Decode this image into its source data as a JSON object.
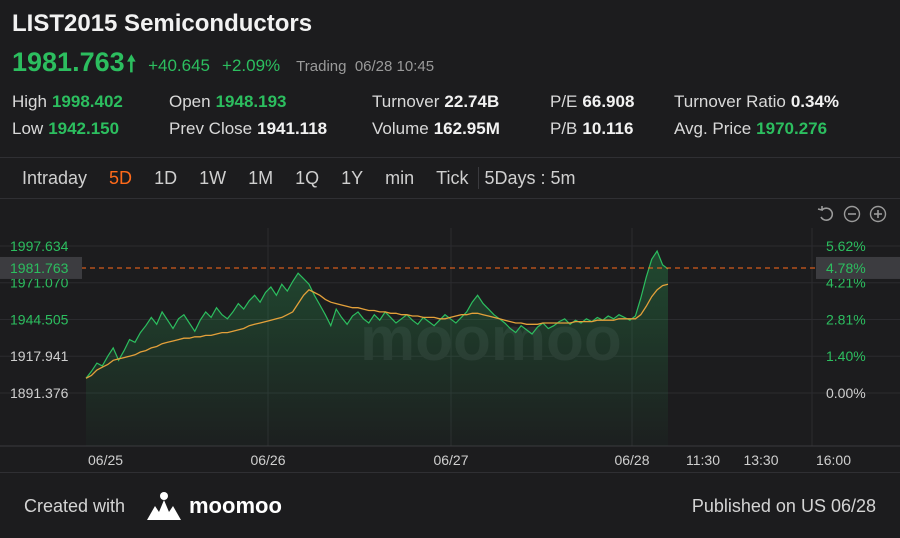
{
  "header": {
    "title": "LIST2015 Semiconductors",
    "price": "1981.763",
    "change": "+40.645",
    "change_pct": "+2.09%",
    "status": "Trading",
    "datetime": "06/28 10:45"
  },
  "stats": {
    "high_label": "High",
    "high": "1998.402",
    "low_label": "Low",
    "low": "1942.150",
    "open_label": "Open",
    "open": "1948.193",
    "prev_close_label": "Prev Close",
    "prev_close": "1941.118",
    "turnover_label": "Turnover",
    "turnover": "22.74B",
    "volume_label": "Volume",
    "volume": "162.95M",
    "pe_label": "P/E",
    "pe": "66.908",
    "pb_label": "P/B",
    "pb": "10.116",
    "turnover_ratio_label": "Turnover Ratio",
    "turnover_ratio": "0.34%",
    "avg_price_label": "Avg. Price",
    "avg_price": "1970.276"
  },
  "tabs": [
    {
      "label": "Intraday",
      "active": false
    },
    {
      "label": "5D",
      "active": true
    },
    {
      "label": "1D",
      "active": false
    },
    {
      "label": "1W",
      "active": false
    },
    {
      "label": "1M",
      "active": false
    },
    {
      "label": "1Q",
      "active": false
    },
    {
      "label": "1Y",
      "active": false
    },
    {
      "label": "min",
      "active": false
    },
    {
      "label": "Tick",
      "active": false
    }
  ],
  "interval": "5Days : 5m",
  "controls": [
    "reset-icon",
    "zoom-out-icon",
    "zoom-in-icon"
  ],
  "colors": {
    "up": "#2cbe5f",
    "avg_line": "#e3a03a",
    "accent": "#ff6a1a",
    "price_line": "#ff6a1a"
  },
  "chart_data": {
    "type": "line",
    "y_ticks": [
      "1997.634",
      "1971.070",
      "1944.505",
      "1917.941",
      "1891.376"
    ],
    "y_tick_values": [
      1997.634,
      1971.07,
      1944.505,
      1917.941,
      1891.376
    ],
    "pct_ticks": [
      "5.62%",
      "4.21%",
      "2.81%",
      "1.40%",
      "0.00%"
    ],
    "current_price_label": "1981.763",
    "current_pct_label": "4.78%",
    "current_price": 1981.763,
    "x_labels": [
      "06/25",
      "06/26",
      "06/27",
      "06/28",
      "11:30",
      "13:30",
      "16:00"
    ],
    "ylim": [
      1891.376,
      1997.634
    ],
    "series": [
      {
        "values": [
          1902,
          1907,
          1913,
          1911,
          1918,
          1924,
          1915,
          1922,
          1930,
          1928,
          1935,
          1940,
          1946,
          1941,
          1950,
          1944,
          1938,
          1945,
          1948,
          1942,
          1936,
          1944,
          1950,
          1946,
          1953,
          1948,
          1945,
          1950,
          1956,
          1952,
          1958,
          1962,
          1957,
          1964,
          1968,
          1962,
          1970,
          1965,
          1972,
          1978,
          1974,
          1970,
          1962,
          1955,
          1948,
          1940,
          1952,
          1946,
          1941,
          1947,
          1950,
          1945,
          1942,
          1948,
          1944,
          1950,
          1946,
          1942,
          1945,
          1948,
          1944,
          1941,
          1946,
          1943,
          1940,
          1944,
          1948,
          1945,
          1942,
          1946,
          1950,
          1957,
          1962,
          1956,
          1952,
          1948,
          1945,
          1942,
          1938,
          1935,
          1940,
          1937,
          1934,
          1939,
          1942,
          1938,
          1940,
          1943,
          1945,
          1941,
          1944,
          1942,
          1945,
          1943,
          1946,
          1944,
          1947,
          1945,
          1948,
          1946,
          1944,
          1947,
          1960,
          1975,
          1988,
          1994,
          1984,
          1981
        ]
      },
      {
        "values": [
          1902,
          1904,
          1908,
          1910,
          1912,
          1915,
          1916,
          1917,
          1918,
          1919,
          1921,
          1922,
          1924,
          1925,
          1927,
          1928,
          1929,
          1930,
          1931,
          1931,
          1932,
          1932,
          1933,
          1933,
          1934,
          1935,
          1935,
          1936,
          1937,
          1938,
          1940,
          1941,
          1942,
          1943,
          1944,
          1945,
          1946,
          1948,
          1950,
          1956,
          1962,
          1966,
          1964,
          1962,
          1959,
          1957,
          1956,
          1955,
          1954,
          1953,
          1953,
          1952,
          1951,
          1951,
          1950,
          1950,
          1949,
          1949,
          1948,
          1948,
          1947,
          1947,
          1946,
          1946,
          1946,
          1945,
          1945,
          1946,
          1947,
          1948,
          1948,
          1949,
          1949,
          1948,
          1947,
          1946,
          1945,
          1944,
          1943,
          1942,
          1942,
          1941,
          1941,
          1941,
          1942,
          1942,
          1942,
          1942,
          1942,
          1942,
          1943,
          1943,
          1943,
          1943,
          1944,
          1944,
          1944,
          1944,
          1945,
          1945,
          1945,
          1945,
          1948,
          1954,
          1961,
          1966,
          1969,
          1970
        ]
      }
    ]
  },
  "footer": {
    "created_with": "Created with",
    "brand": "moomoo",
    "published": "Published on US 06/28"
  }
}
